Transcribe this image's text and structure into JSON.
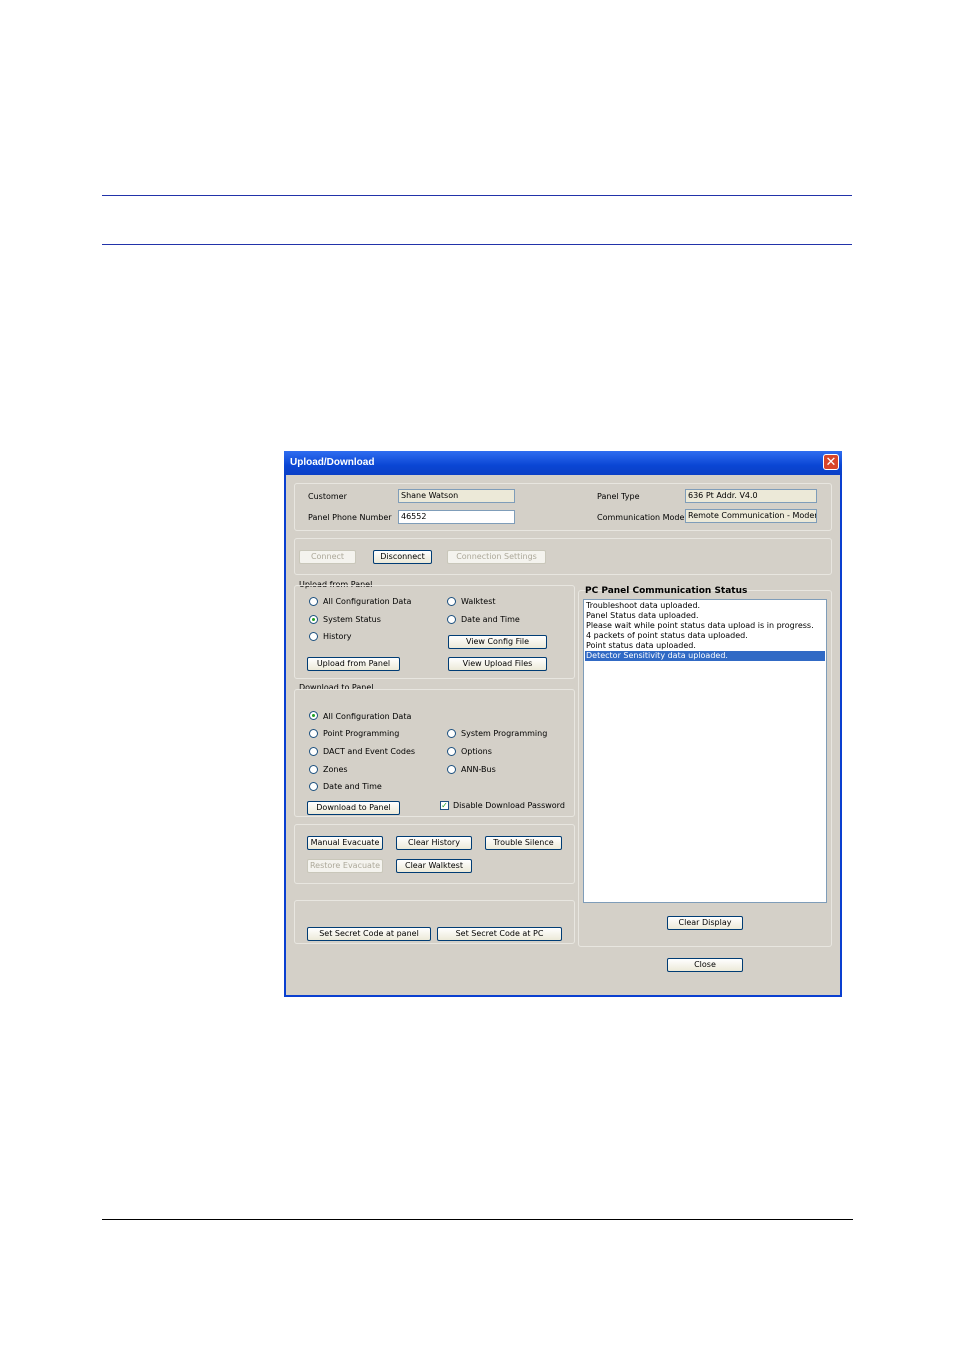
{
  "window": {
    "title": "Upload/Download",
    "close_glyph": "✕",
    "title_color": "#0a46d4"
  },
  "header": {
    "customer_label": "Customer",
    "customer_value": "Shane Watson",
    "phone_label": "Panel Phone Number",
    "phone_value": "46552",
    "panel_type_label": "Panel Type",
    "panel_type_value": "636 Pt Addr. V4.0",
    "comm_mode_label": "Communication Mode",
    "comm_mode_value": "Remote Communication - Modem"
  },
  "connection": {
    "connect": "Connect",
    "disconnect": "Disconnect",
    "settings": "Connection Settings"
  },
  "upload": {
    "group_label": "Upload from Panel",
    "options": [
      "All Configuration Data",
      "System Status",
      "History",
      "Walktest",
      "Date and Time"
    ],
    "selected": "System Status",
    "view_config": "View Config File",
    "upload_button": "Upload from Panel",
    "view_upload": "View Upload Files"
  },
  "download": {
    "group_label": "Download to Panel",
    "options": [
      "All Configuration Data",
      "Point Programming",
      "DACT and Event Codes",
      "Zones",
      "Date and Time",
      "System Programming",
      "Options",
      "ANN-Bus"
    ],
    "selected": "All Configuration Data",
    "download_button": "Download to Panel",
    "disable_password_label": "Disable Download Password",
    "disable_password_checked": true
  },
  "actions": {
    "manual_evacuate": "Manual Evacuate",
    "clear_history": "Clear History",
    "trouble_silence": "Trouble Silence",
    "restore_evacuate": "Restore Evacuate",
    "clear_walktest": "Clear Walktest"
  },
  "secret": {
    "at_panel": "Set Secret Code at panel",
    "at_pc": "Set Secret Code at PC"
  },
  "status": {
    "title": "PC Panel Communication Status",
    "lines": [
      "Troubleshoot data uploaded.",
      "Panel Status data uploaded.",
      "Please wait while point status data upload is in progress.",
      "4 packets of point status data uploaded.",
      "Point status data uploaded.",
      "Detector Sensitivity data uploaded."
    ],
    "selected_index": 5,
    "clear_display": "Clear Display"
  },
  "footer": {
    "close": "Close"
  }
}
